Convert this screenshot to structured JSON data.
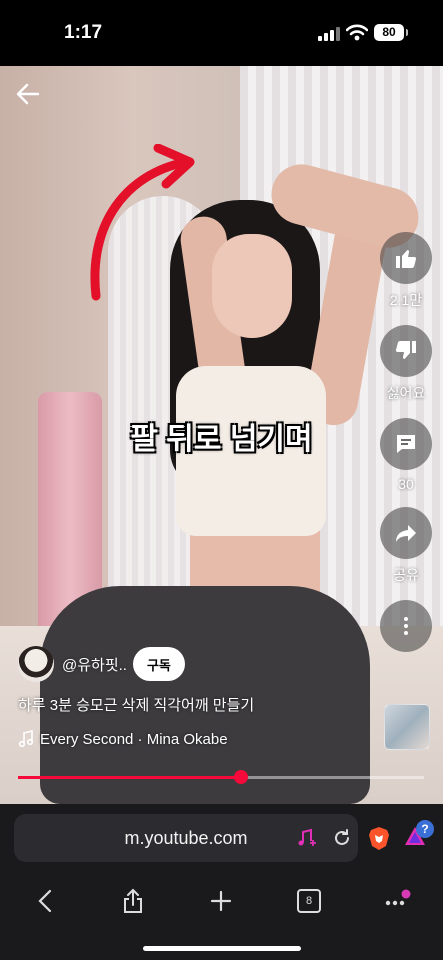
{
  "status": {
    "time": "1:17",
    "battery": "80"
  },
  "video": {
    "caption": "팔 뒤로 넘기며",
    "actions": [
      {
        "name": "like",
        "label": "2.1만"
      },
      {
        "name": "dislike",
        "label": "싫어요"
      },
      {
        "name": "comments",
        "label": "30"
      },
      {
        "name": "share",
        "label": "공유"
      },
      {
        "name": "more",
        "label": ""
      }
    ],
    "channel": {
      "handle": "@유하핏..",
      "subscribe": "구독"
    },
    "title": "하루 3분 승모근 삭제 직각어깨 만들기",
    "music": "Every Second · Mina Okabe",
    "progress": 0.55,
    "colors": {
      "accent": "#f50a3a",
      "arrow": "#e4102a"
    }
  },
  "browser": {
    "url": "m.youtube.com",
    "tabs": "8",
    "notification_badge": "?"
  }
}
